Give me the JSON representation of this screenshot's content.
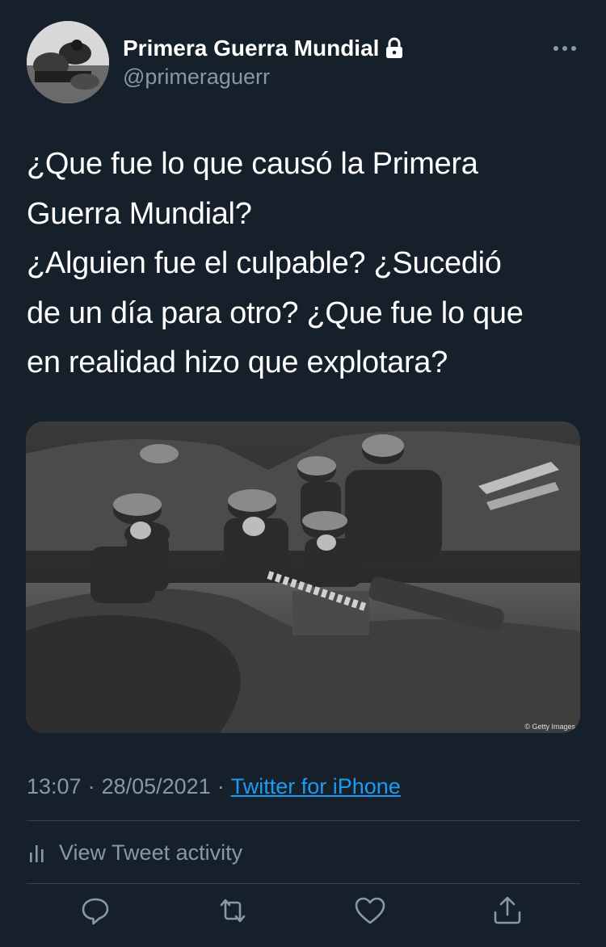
{
  "user": {
    "display_name": "Primera Guerra Mundial",
    "handle": "@primeraguerr",
    "protected_icon": "lock-icon",
    "avatar_icon": "avatar-photo"
  },
  "tweet": {
    "lines": [
      "¿Que fue lo que causó la Primera",
      "Guerra Mundial?",
      "¿Alguien fue el culpable? ¿Sucedió",
      "de un día para otro? ¿Que fue lo que",
      "en realidad hizo que explotara?"
    ],
    "media": {
      "credit": "© Getty Images"
    },
    "time": "13:07",
    "date": "28/05/2021",
    "separator": "·",
    "source": "Twitter for iPhone"
  },
  "activity": {
    "label": "View Tweet activity",
    "icon": "bar-chart-icon"
  },
  "actions": [
    {
      "name": "reply",
      "icon": "reply-icon"
    },
    {
      "name": "retweet",
      "icon": "retweet-icon"
    },
    {
      "name": "like",
      "icon": "heart-icon"
    },
    {
      "name": "share",
      "icon": "share-icon"
    }
  ],
  "colors": {
    "background": "#15202b",
    "text_primary": "#ffffff",
    "text_secondary": "#8899a6",
    "link": "#1d9bf0",
    "divider": "#38444d"
  }
}
